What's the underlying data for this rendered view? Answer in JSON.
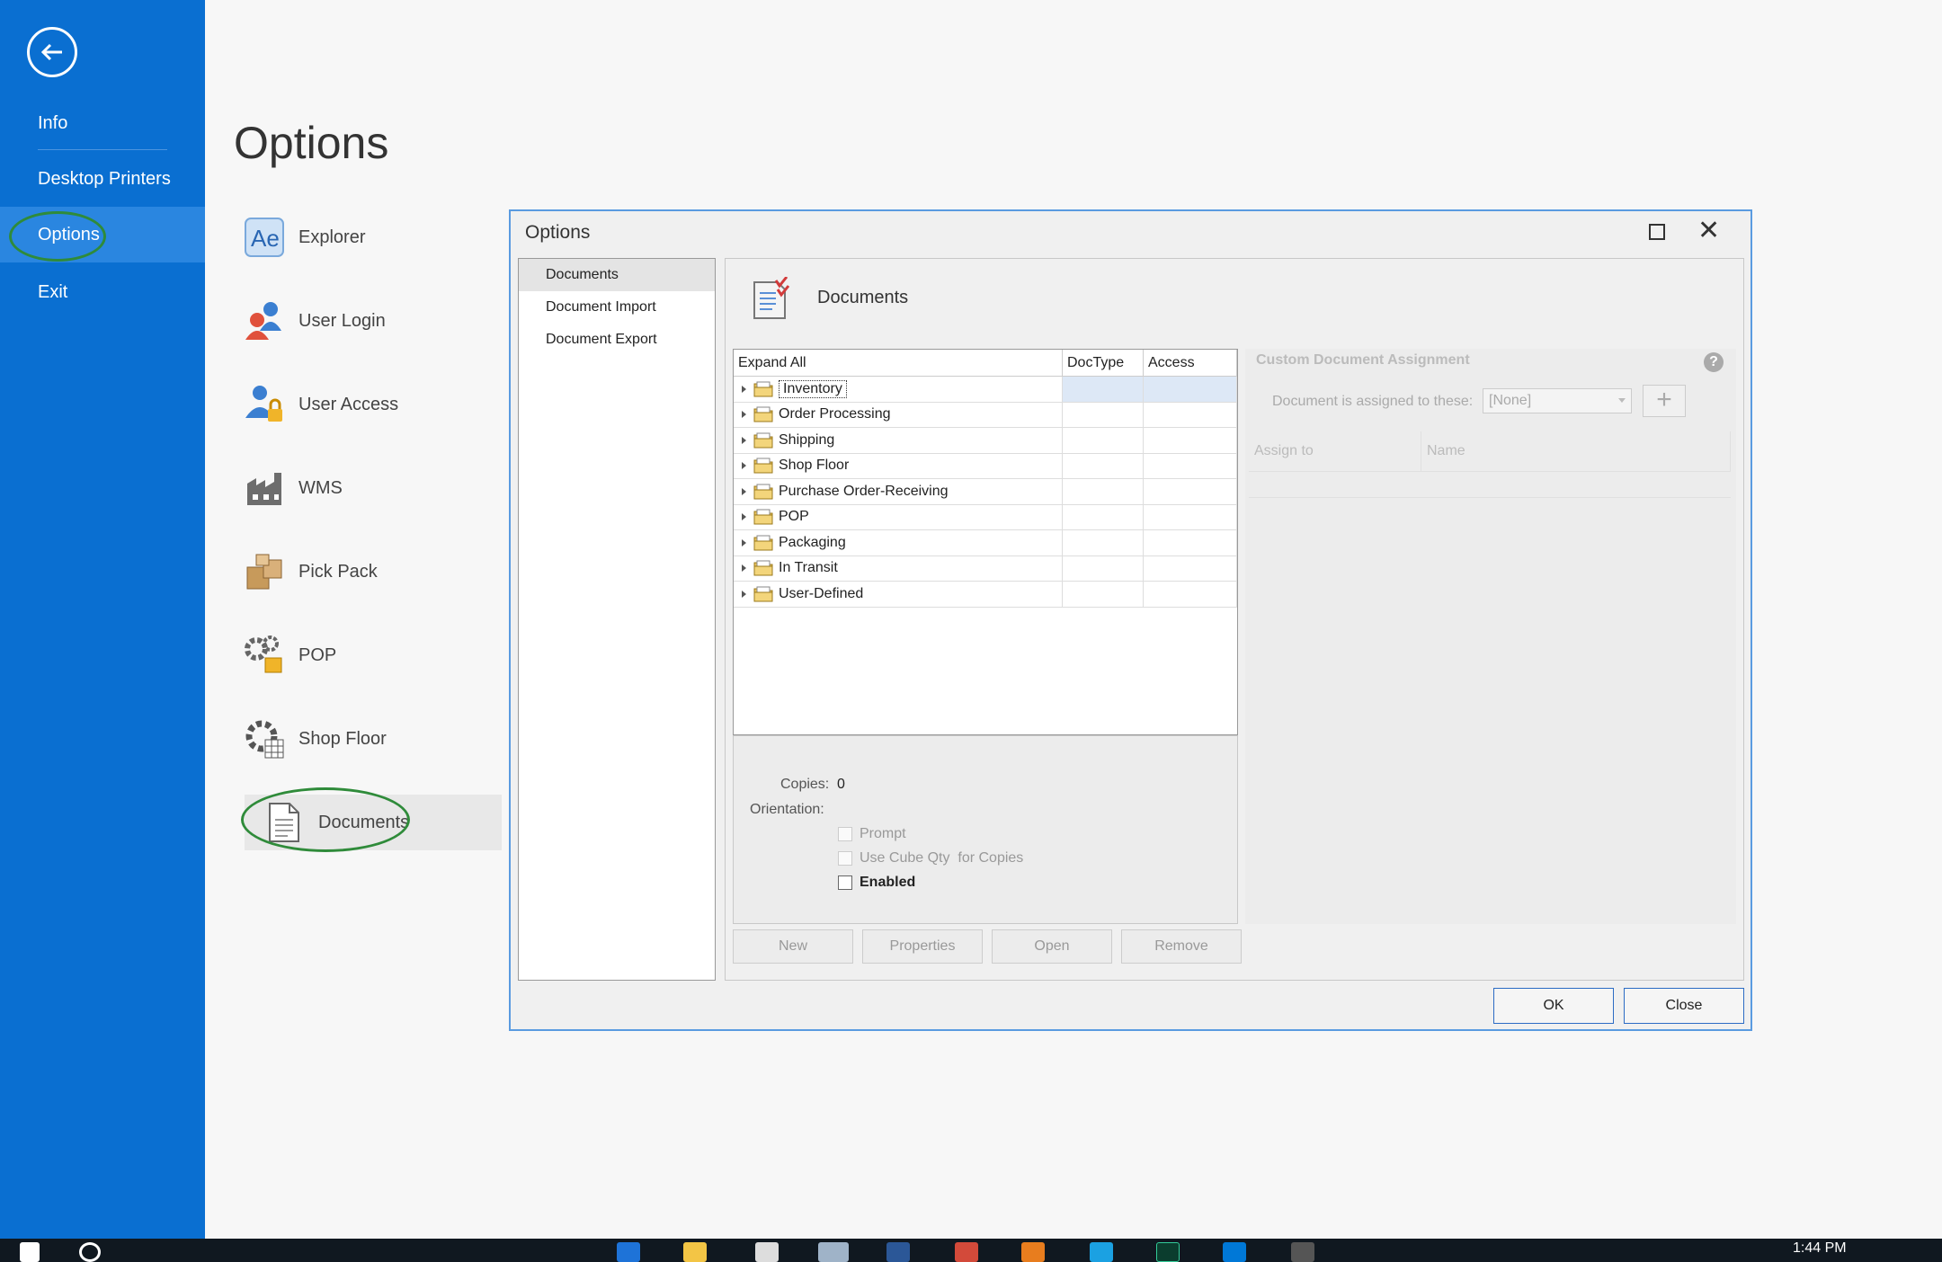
{
  "backstage": {
    "items": [
      {
        "label": "Info"
      },
      {
        "label": "Desktop Printers"
      },
      {
        "label": "Options"
      },
      {
        "label": "Exit"
      }
    ]
  },
  "page": {
    "title": "Options"
  },
  "categories": [
    {
      "label": "Explorer",
      "icon": "ae-icon"
    },
    {
      "label": "User Login",
      "icon": "users-icon"
    },
    {
      "label": "User Access",
      "icon": "user-lock-icon"
    },
    {
      "label": "WMS",
      "icon": "factory-icon"
    },
    {
      "label": "Pick Pack",
      "icon": "boxes-icon"
    },
    {
      "label": "POP",
      "icon": "gears-box-icon"
    },
    {
      "label": "Shop Floor",
      "icon": "gear-grid-icon"
    },
    {
      "label": "Documents",
      "icon": "document-icon"
    }
  ],
  "dialog": {
    "title": "Options",
    "nav": [
      {
        "label": "Documents"
      },
      {
        "label": "Document Import"
      },
      {
        "label": "Document Export"
      }
    ],
    "panel_title": "Documents",
    "tree": {
      "headers": [
        "Expand All",
        "DocType",
        "Access"
      ],
      "rows": [
        "Inventory",
        "Order Processing",
        "Shipping",
        "Shop Floor",
        "Purchase Order-Receiving",
        "POP",
        "Packaging",
        "In Transit",
        "User-Defined"
      ]
    },
    "props": {
      "copies_label": "Copies:",
      "copies_value": "0",
      "orientation_label": "Orientation:",
      "prompt": "Prompt",
      "cube_qty": "Use Cube Qty  for Copies",
      "enabled": "Enabled"
    },
    "buttons": {
      "new": "New",
      "properties": "Properties",
      "open": "Open",
      "remove": "Remove",
      "ok": "OK",
      "close": "Close"
    },
    "cda": {
      "title": "Custom Document Assignment",
      "assigned_label": "Document is assigned to these:",
      "assigned_value": "[None]",
      "col_assign": "Assign to",
      "col_name": "Name",
      "add": "+"
    }
  },
  "taskbar": {
    "time": "1:44 PM"
  },
  "colors": {
    "accent": "#0a6fd1",
    "ring": "#2f8b3a",
    "selection": "#dde8f6"
  }
}
